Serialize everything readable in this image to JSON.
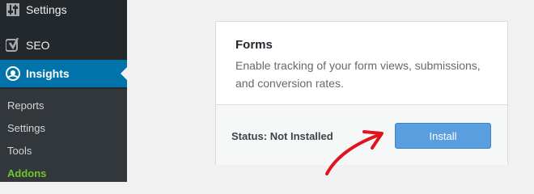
{
  "sidebar": {
    "menu": [
      {
        "label": "Settings",
        "icon": "settings-sliders-icon"
      },
      {
        "label": "SEO",
        "icon": "yoast-icon"
      },
      {
        "label": "Insights",
        "icon": "insights-icon"
      }
    ],
    "submenu": [
      "Reports",
      "Settings",
      "Tools",
      "Addons"
    ]
  },
  "addon_card": {
    "title": "Forms",
    "description": "Enable tracking of your form views, submissions, and conversion rates.",
    "status_label": "Status:",
    "status_value": "Not Installed",
    "install_label": "Install"
  },
  "colors": {
    "sidebar_bg": "#23282d",
    "active_menu": "#0073aa",
    "current_submenu": "#72c42b",
    "install_button": "#5a9ee0",
    "arrow": "#e0141e"
  }
}
